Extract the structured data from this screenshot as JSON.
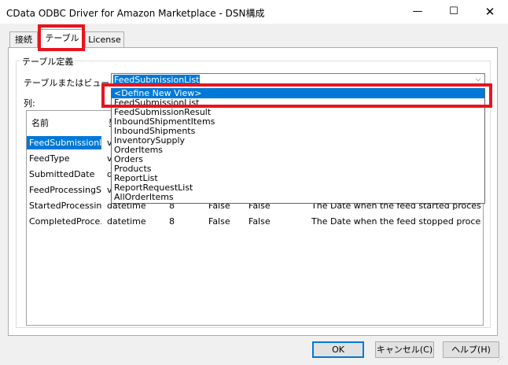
{
  "window": {
    "title": "CData ODBC Driver for Amazon Marketplace - DSN構成",
    "min_glyph": "—",
    "max_glyph": "☐",
    "close_glyph": "✕"
  },
  "tabs": [
    {
      "label": "接続"
    },
    {
      "label": "テーブル"
    },
    {
      "label": "License"
    }
  ],
  "group": {
    "label": "テーブル定義",
    "view_label": "テーブルまたはビュー:",
    "columns_label": "列:"
  },
  "combo": {
    "value": "FeedSubmissionList",
    "arrow_glyph": "⌵"
  },
  "dropdown": {
    "items": [
      "<Define New View>",
      "FeedSubmissionList",
      "FeedSubmissionResult",
      "InboundShipmentItems",
      "InboundShipments",
      "InventorySupply",
      "OrderItems",
      "Orders",
      "Products",
      "ReportList",
      "ReportRequestList",
      "AllOrderItems"
    ]
  },
  "table": {
    "headers": [
      "名前",
      "型"
    ],
    "rows": [
      [
        "FeedSubmissionId",
        "v",
        "",
        "",
        "",
        ""
      ],
      [
        "FeedType",
        "v",
        "",
        "",
        "",
        ""
      ],
      [
        "SubmittedDate",
        "d",
        "",
        "",
        "",
        ""
      ],
      [
        "FeedProcessingS...",
        "v",
        "",
        "",
        "",
        ""
      ],
      [
        "StartedProcessin...",
        "datetime",
        "8",
        "False",
        "False",
        "The Date when the feed started process..."
      ],
      [
        "CompletedProce...",
        "datetime",
        "8",
        "False",
        "False",
        "The Date when the feed stopped proces..."
      ]
    ]
  },
  "buttons": {
    "ok": "OK",
    "cancel": "キャンセル(C)",
    "help": "ヘルプ(H)"
  }
}
